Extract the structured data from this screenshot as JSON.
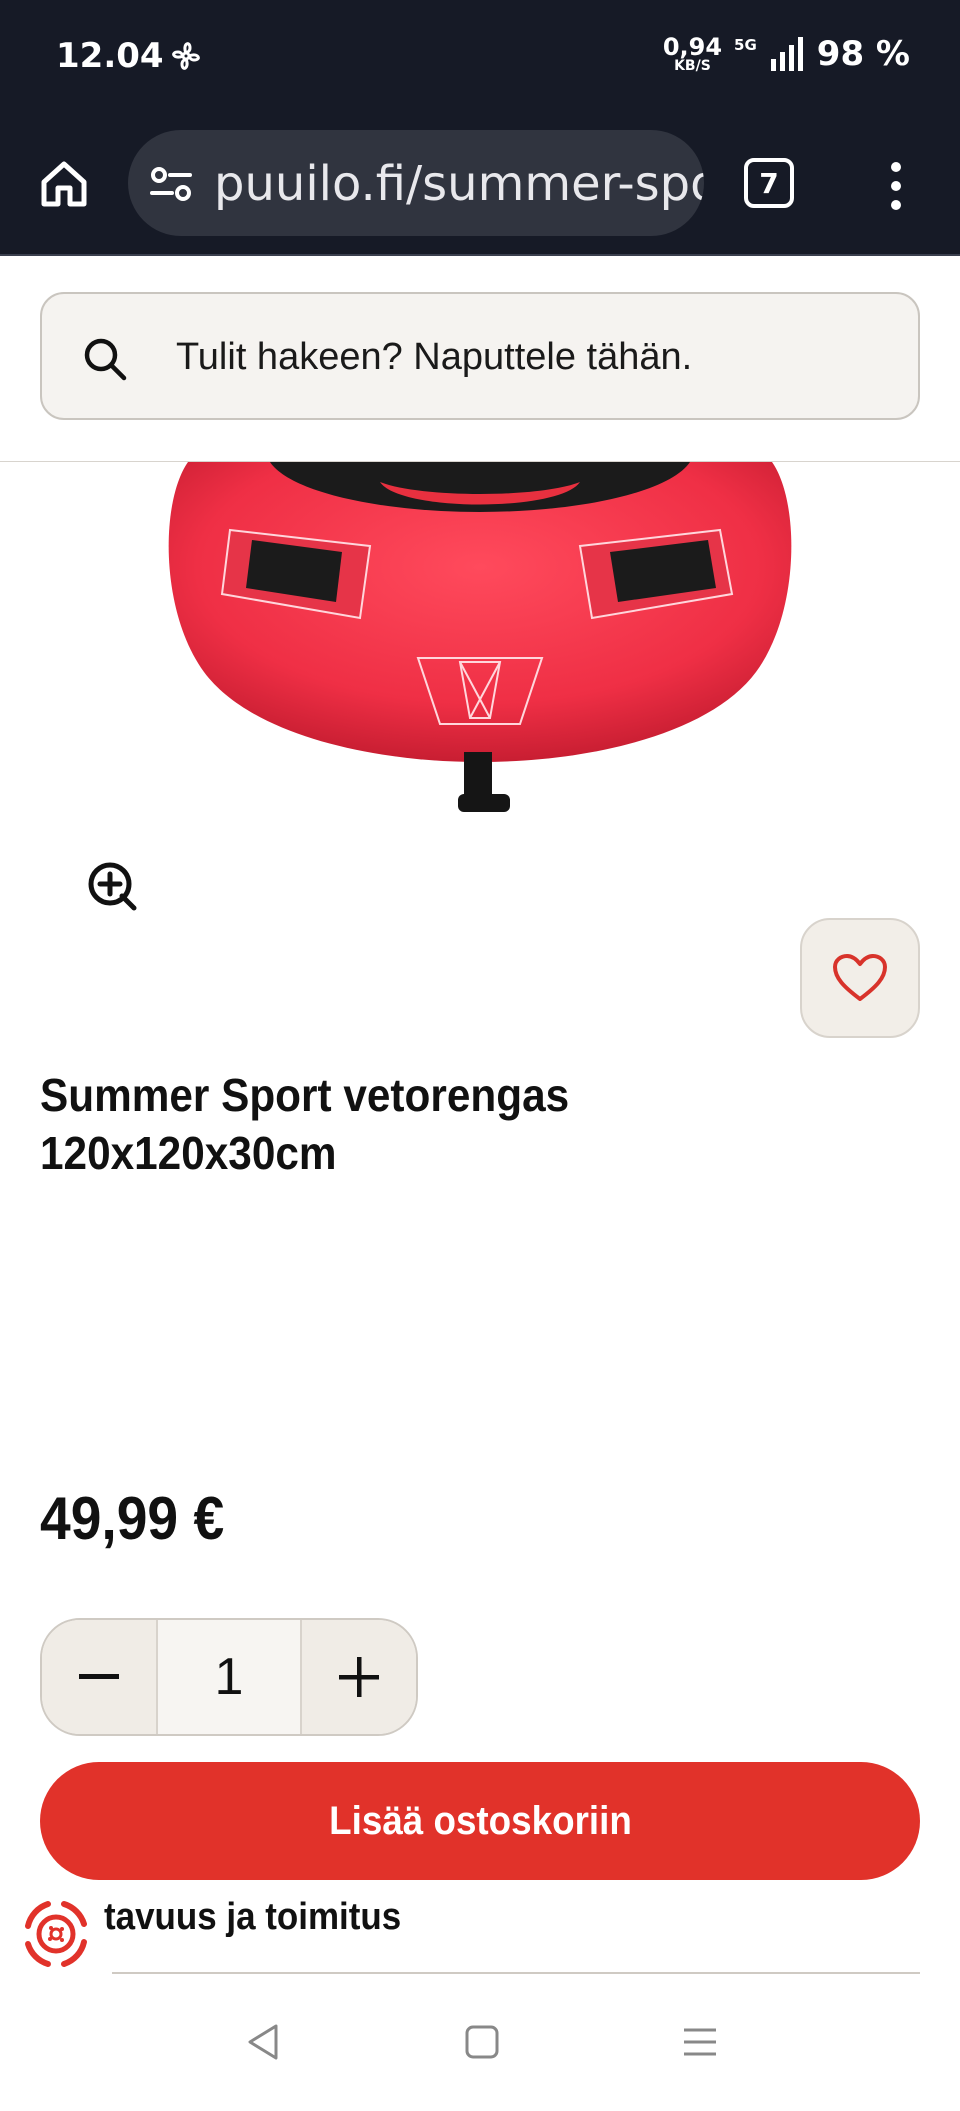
{
  "status_bar": {
    "time": "12.04",
    "net_speed_value": "0,94",
    "net_speed_unit": "KB/S",
    "network": "5G",
    "battery": "98 %"
  },
  "browser": {
    "url": "puuilo.fi/summer-sport",
    "tab_count": "7"
  },
  "search": {
    "placeholder": "Tulit hakeen? Naputtele tähän."
  },
  "product": {
    "title_line1": "Summer Sport vetorengas",
    "title_line2": "120x120x30cm",
    "price": "49,99 €",
    "quantity": "1",
    "add_to_cart_label": "Lisää ostoskoriin",
    "availability_label": "tavuus ja toimitus"
  },
  "icons": {
    "home": "home-icon",
    "site_settings": "tune-icon",
    "menu": "more-vert-icon",
    "search": "search-icon",
    "zoom": "zoom-in-icon",
    "favorite": "heart-icon",
    "minus": "minus-icon",
    "plus": "plus-icon",
    "tire_logo": "tire-logo-icon"
  },
  "colors": {
    "brand_red": "#e1322a",
    "status_bar_bg": "#161a26"
  }
}
